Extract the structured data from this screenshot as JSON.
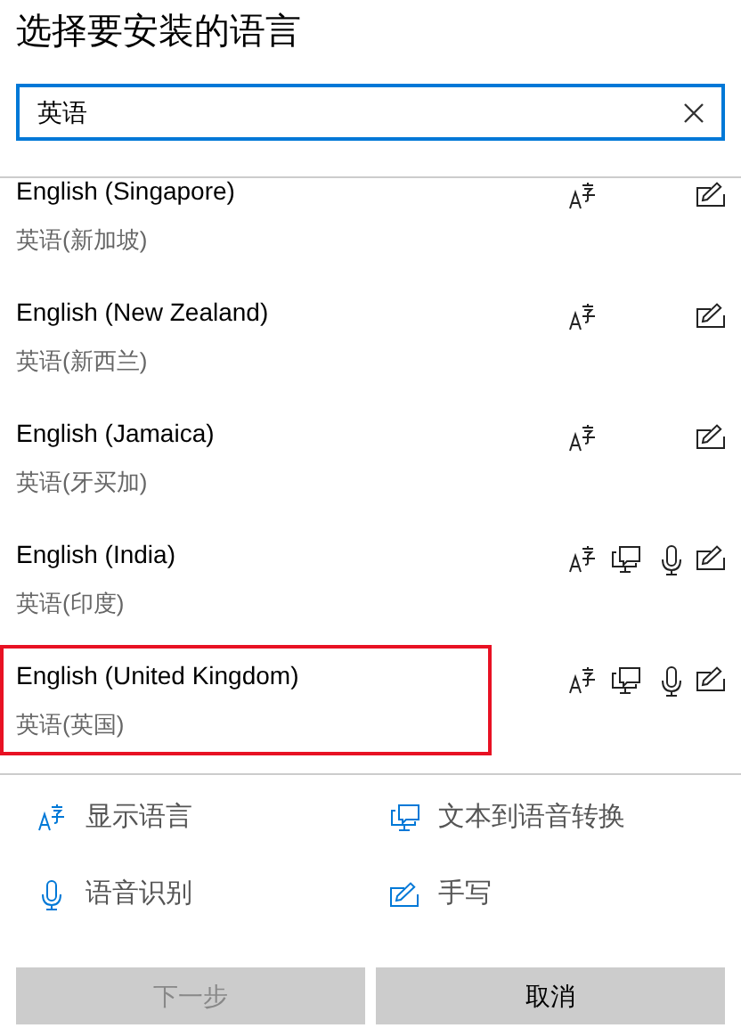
{
  "title": "选择要安装的语言",
  "search": {
    "value": "英语"
  },
  "languages": [
    {
      "name": "English (Singapore)",
      "native": "英语(新加坡)",
      "selected": false,
      "display": true,
      "tts": false,
      "speech": false,
      "handwriting": true
    },
    {
      "name": "English (New Zealand)",
      "native": "英语(新西兰)",
      "selected": false,
      "display": true,
      "tts": false,
      "speech": false,
      "handwriting": true
    },
    {
      "name": "English (Jamaica)",
      "native": "英语(牙买加)",
      "selected": false,
      "display": true,
      "tts": false,
      "speech": false,
      "handwriting": true
    },
    {
      "name": "English (India)",
      "native": "英语(印度)",
      "selected": false,
      "display": true,
      "tts": true,
      "speech": true,
      "handwriting": true
    },
    {
      "name": "English (United Kingdom)",
      "native": "英语(英国)",
      "selected": true,
      "display": true,
      "tts": true,
      "speech": true,
      "handwriting": true
    }
  ],
  "legend": [
    {
      "kind": "display",
      "label": "显示语言"
    },
    {
      "kind": "tts",
      "label": "文本到语音转换"
    },
    {
      "kind": "speech",
      "label": "语音识别"
    },
    {
      "kind": "handwriting",
      "label": "手写"
    }
  ],
  "buttons": [
    {
      "label": "下一步",
      "disabled": true
    },
    {
      "label": "取消",
      "disabled": false
    }
  ]
}
